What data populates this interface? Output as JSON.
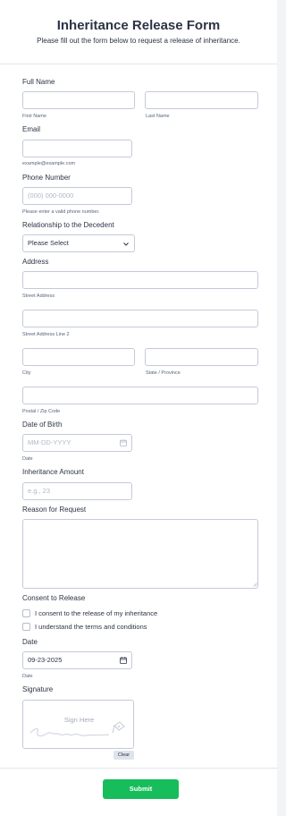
{
  "header": {
    "title": "Inheritance Release Form",
    "subtitle": "Please fill out the form below to request a release of inheritance."
  },
  "full_name": {
    "label": "Full Name",
    "first_sublabel": "First Name",
    "last_sublabel": "Last Name",
    "first_value": "",
    "last_value": ""
  },
  "email": {
    "label": "Email",
    "value": "",
    "sublabel": "example@example.com"
  },
  "phone": {
    "label": "Phone Number",
    "placeholder": "(000) 000-0000",
    "sublabel": "Please enter a valid phone number."
  },
  "relationship": {
    "label": "Relationship to the Decedent",
    "selected": "Please Select"
  },
  "address": {
    "label": "Address",
    "street_sublabel": "Street Address",
    "street2_sublabel": "Street Address Line 2",
    "city_sublabel": "City",
    "state_sublabel": "State / Province",
    "postal_sublabel": "Postal / Zip Code"
  },
  "dob": {
    "label": "Date of Birth",
    "placeholder": "MM-DD-YYYY",
    "sublabel": "Date"
  },
  "amount": {
    "label": "Inheritance Amount",
    "placeholder": "e.g., 23"
  },
  "reason": {
    "label": "Reason for Request",
    "value": ""
  },
  "consent": {
    "label": "Consent to Release",
    "options": [
      "I consent to the release of my inheritance",
      "I understand the terms and conditions"
    ]
  },
  "date": {
    "label": "Date",
    "value": "09-23-2025",
    "sublabel": "Date"
  },
  "signature": {
    "label": "Signature",
    "prompt": "Sign Here",
    "clear_label": "Clear"
  },
  "submit_label": "Submit",
  "colors": {
    "submit": "#18bd5b",
    "border": "#c3cad8",
    "text": "#2c3345"
  }
}
